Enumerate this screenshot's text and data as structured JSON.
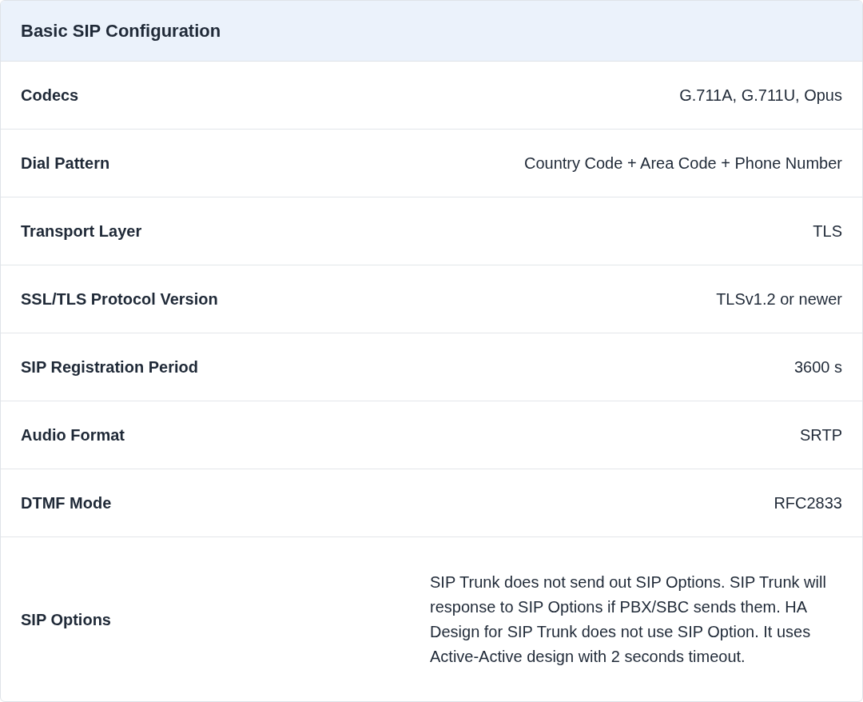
{
  "title": "Basic SIP Configuration",
  "rows": [
    {
      "label": "Codecs",
      "value": "G.711A, G.711U, Opus",
      "kind": "short"
    },
    {
      "label": "Dial Pattern",
      "value": "Country Code + Area Code + Phone Number",
      "kind": "short"
    },
    {
      "label": "Transport Layer",
      "value": "TLS",
      "kind": "short"
    },
    {
      "label": "SSL/TLS Protocol Version",
      "value": "TLSv1.2 or newer",
      "kind": "short"
    },
    {
      "label": "SIP Registration Period",
      "value": "3600 s",
      "kind": "short"
    },
    {
      "label": "Audio Format",
      "value": "SRTP",
      "kind": "short"
    },
    {
      "label": "DTMF Mode",
      "value": "RFC2833",
      "kind": "short"
    },
    {
      "label": "SIP Options",
      "value": "SIP Trunk does not send out SIP Options. SIP Trunk will response to SIP Options if PBX/SBC sends them. HA Design for SIP Trunk does not use SIP Option. It uses Active-Active design with 2 seconds timeout.",
      "kind": "long"
    }
  ]
}
